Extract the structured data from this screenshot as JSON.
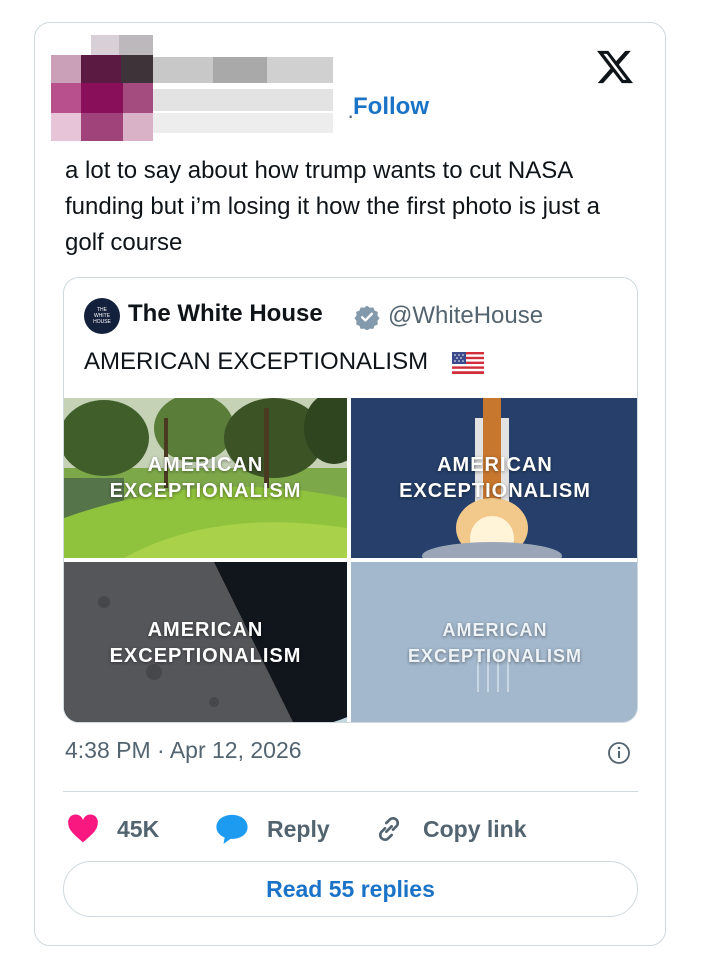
{
  "author": {
    "follow_label": "Follow"
  },
  "tweet": {
    "text": "a lot to say about how trump wants to cut NASA funding but i’m losing it how the first photo is just a golf course",
    "timestamp": "4:38 PM · Apr 12, 2026"
  },
  "quoted": {
    "name": "The White House",
    "handle": "@WhiteHouse",
    "text": "AMERICAN EXCEPTIONALISM",
    "avatar_text": "THE WHITE HOUSE",
    "images": [
      {
        "label_line1": "AMERICAN",
        "label_line2": "EXCEPTIONALISM"
      },
      {
        "label_line1": "AMERICAN",
        "label_line2": "EXCEPTIONALISM"
      },
      {
        "label_line1": "AMERICAN",
        "label_line2": "EXCEPTIONALISM"
      },
      {
        "label_line1": "AMERICAN",
        "label_line2": "EXCEPTIONALISM"
      }
    ]
  },
  "actions": {
    "likes": "45K",
    "reply_label": "Reply",
    "copy_label": "Copy link"
  },
  "read_replies_label": "Read 55 replies",
  "colors": {
    "accent_blue": "#1a73c7",
    "like_pink": "#f91880",
    "border": "#cfd9de",
    "muted": "#536471"
  },
  "icons": [
    "x-logo-icon",
    "verified-badge-icon",
    "us-flag-icon",
    "info-icon",
    "heart-icon",
    "reply-bubble-icon",
    "link-icon"
  ]
}
